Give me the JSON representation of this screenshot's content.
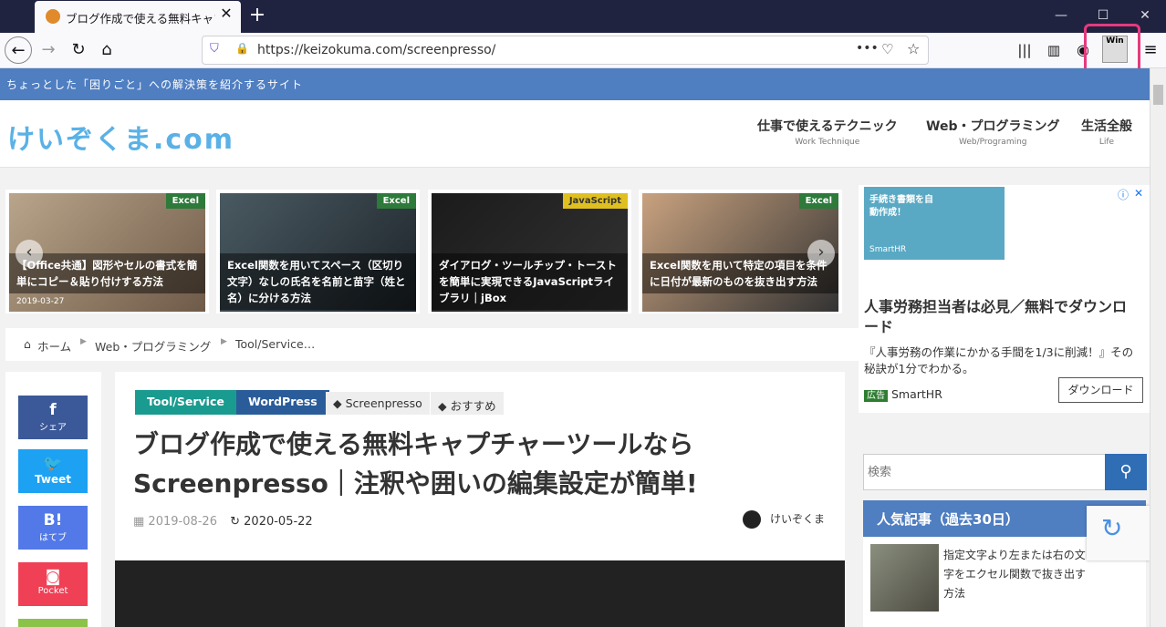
{
  "browser": {
    "tab_title": "ブログ作成で使える無料キャプチャーツールなら",
    "tab_close": "✕",
    "new_tab": "+",
    "url": "https://keizokuma.com/screenpresso/",
    "url_display_host": "keizokuma.com",
    "extension_label": "Win",
    "window_controls": [
      "—",
      "☐",
      "✕"
    ]
  },
  "site": {
    "tagline": "ちょっとした「困りごと」への解決策を紹介するサイト",
    "logo": "けいぞくま.com",
    "nav": [
      {
        "main": "仕事で使えるテクニック",
        "sub": "Work Technique"
      },
      {
        "main": "Web・プログラミング",
        "sub": "Web/Programing"
      },
      {
        "main": "生活全般",
        "sub": "Life"
      }
    ]
  },
  "carousel": [
    {
      "tag": "Excel",
      "title": "【Office共通】図形やセルの書式を簡単にコピー＆貼り付けする方法",
      "date": "2019-03-27"
    },
    {
      "tag": "Excel",
      "title": "Excel関数を用いてスペース（区切り文字）なしの氏名を名前と苗字（姓と名）に分ける方法",
      "date": ""
    },
    {
      "tag": "JavaScript",
      "title": "ダイアログ・ツールチップ・トーストを簡単に実現できるJavaScriptライブラリ｜jBox",
      "date": ""
    },
    {
      "tag": "Excel",
      "title": "Excel関数を用いて特定の項目を条件に日付が最新のものを抜き出す方法",
      "date": ""
    }
  ],
  "breadcrumb": [
    "ホーム",
    "Web・プログラミング",
    "Tool/Service…"
  ],
  "share": [
    {
      "icon": "f",
      "label": "シェア",
      "color": "#3b5998"
    },
    {
      "icon": "🐦",
      "label": "Tweet",
      "color": "#1da1f2"
    },
    {
      "icon": "B!",
      "label": "はてブ",
      "color": "#5279e7"
    },
    {
      "icon": "◙",
      "label": "Pocket",
      "color": "#ef4056"
    }
  ],
  "article": {
    "categories": [
      "Tool/Service",
      "WordPress"
    ],
    "tags": [
      "Screenpresso",
      "おすすめ"
    ],
    "title": "ブログ作成で使える無料キャプチャーツールならScreenpresso｜注釈や囲いの編集設定が簡単!",
    "published": "2019-08-26",
    "updated": "2020-05-22",
    "author": "けいぞくま"
  },
  "ad": {
    "image_text": "手続き書類を自動作成！",
    "image_brand": "SmartHR",
    "title": "人事労務担当者は必見／無料でダウンロード",
    "desc": "『人事労務の作業にかかる手間を1/3に削減！』その秘訣が1分でわかる。",
    "sponsor_badge": "広告",
    "sponsor": "SmartHR",
    "button": "ダウンロード"
  },
  "sidebar": {
    "search_placeholder": "検索",
    "popular_title": "人気記事（過去30日）",
    "popular_item": "指定文字より左または右の文字をエクセル関数で抜き出す方法"
  },
  "colors": {
    "accent": "#4f7ec1",
    "highlight": "#e6397e",
    "tool_service": "#1a9b8f",
    "wordpress": "#2a5c9a"
  }
}
